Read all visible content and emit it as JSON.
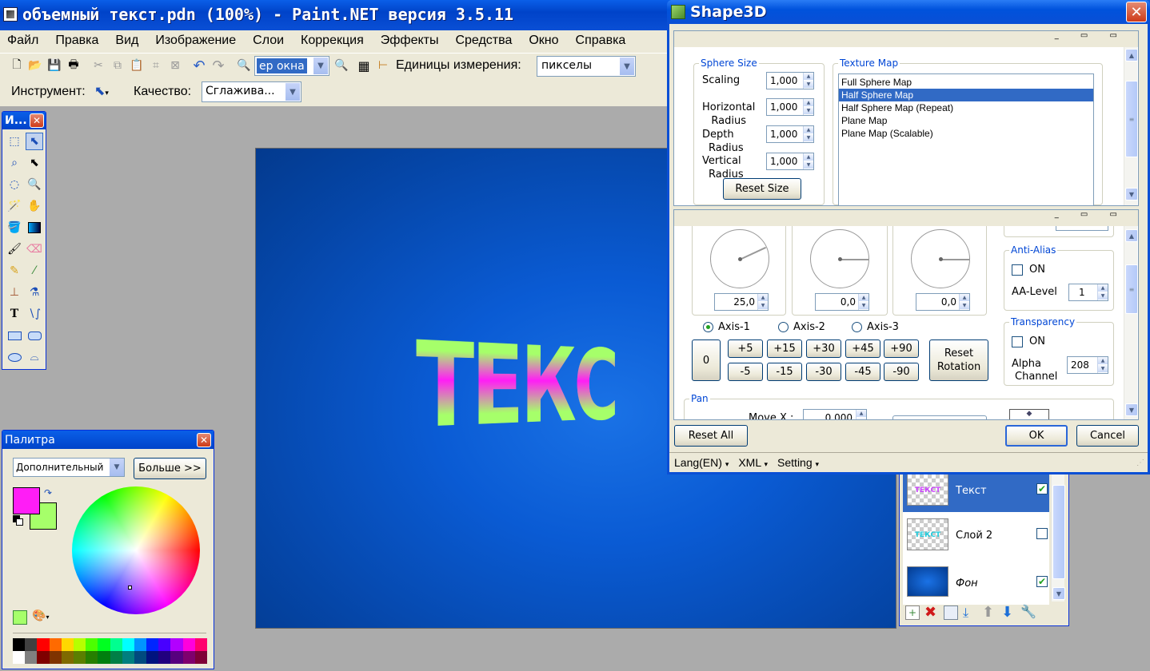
{
  "app": {
    "title": "объемный текст.pdn (100%) - Paint.NET версия 3.5.11",
    "menu": [
      "Файл",
      "Правка",
      "Вид",
      "Изображение",
      "Слои",
      "Коррекция",
      "Эффекты",
      "Средства",
      "Окно",
      "Справка"
    ],
    "zoom_value": "ер окна",
    "units_label": "Единицы измерения:",
    "units_value": "пикселы",
    "tool_label": "Инструмент:",
    "quality_label": "Качество:",
    "quality_value": "Сглажива..."
  },
  "toolbox": {
    "title": "И..."
  },
  "canvas": {
    "text": "ТЕКС"
  },
  "palette": {
    "title": "Палитра",
    "dropdown_value": "Дополнительный",
    "more_button": "Больше >>",
    "primary_color": "#ff1df6",
    "secondary_color": "#a6ff6a",
    "swatches_row1": [
      "#000000",
      "#404040",
      "#ff0000",
      "#ff6a00",
      "#ffd800",
      "#b6ff00",
      "#4cff00",
      "#00ff21",
      "#00ff90",
      "#00ffff",
      "#0094ff",
      "#0026ff",
      "#4800ff",
      "#b200ff",
      "#ff00dc",
      "#ff006e"
    ],
    "swatches_row2": [
      "#ffffff",
      "#808080",
      "#7f0000",
      "#7f3300",
      "#7f6a00",
      "#5b7f00",
      "#267f00",
      "#007f0e",
      "#007f46",
      "#007f7f",
      "#004a7f",
      "#00137f",
      "#21007f",
      "#57007f",
      "#7f006e",
      "#7f0037"
    ]
  },
  "layers": [
    {
      "name": "Текст",
      "visible": true,
      "thumb": "ТЕКСТ"
    },
    {
      "name": "Слой 2",
      "visible": false,
      "thumb": "ТЕКСТ"
    },
    {
      "name": "Фон",
      "visible": true,
      "thumb": ""
    }
  ],
  "shape3d": {
    "title": "Shape3D",
    "sphere_size": {
      "label": "Sphere Size",
      "scaling_label": "Scaling",
      "scaling": "1,000",
      "horizontal_label_1": "Horizontal",
      "horizontal_label_2": "Radius",
      "horizontal": "1,000",
      "depth_label_1": "Depth",
      "depth_label_2": "Radius",
      "depth": "1,000",
      "vertical_label_1": "Vertical",
      "vertical_label_2": "Radius",
      "vertical": "1,000",
      "reset_button": "Reset Size"
    },
    "texture_map": {
      "label": "Texture Map",
      "items": [
        "Full Sphere Map",
        "Half Sphere Map",
        "Half Sphere Map (Repeat)",
        "Plane Map",
        "Plane Map (Scalable)"
      ],
      "selected_index": 1
    },
    "rotation": {
      "dial1": "25,0",
      "dial2": "0,0",
      "dial3": "0,0",
      "axis1": "Axis-1",
      "axis2": "Axis-2",
      "axis3": "Axis-3",
      "selected_axis": 1,
      "zero": "0",
      "plus": [
        "+5",
        "+15",
        "+30",
        "+45",
        "+90"
      ],
      "minus": [
        "-5",
        "-15",
        "-30",
        "-45",
        "-90"
      ],
      "reset_1": "Reset",
      "reset_2": "Rotation"
    },
    "anti_alias": {
      "label": "Anti-Alias",
      "on_label": "ON",
      "level_label": "AA-Level",
      "level": "1"
    },
    "transparency": {
      "label": "Transparency",
      "on_label": "ON",
      "alpha_label_1": "Alpha",
      "alpha_label_2": "Channel",
      "alpha": "208"
    },
    "pan": {
      "label": "Pan",
      "move_x_label": "Move X :",
      "move_x": "0,000"
    },
    "buttons": {
      "reset_all": "Reset All",
      "ok": "OK",
      "cancel": "Cancel"
    },
    "status_menu": [
      "Lang(EN)",
      "XML",
      "Setting"
    ]
  }
}
